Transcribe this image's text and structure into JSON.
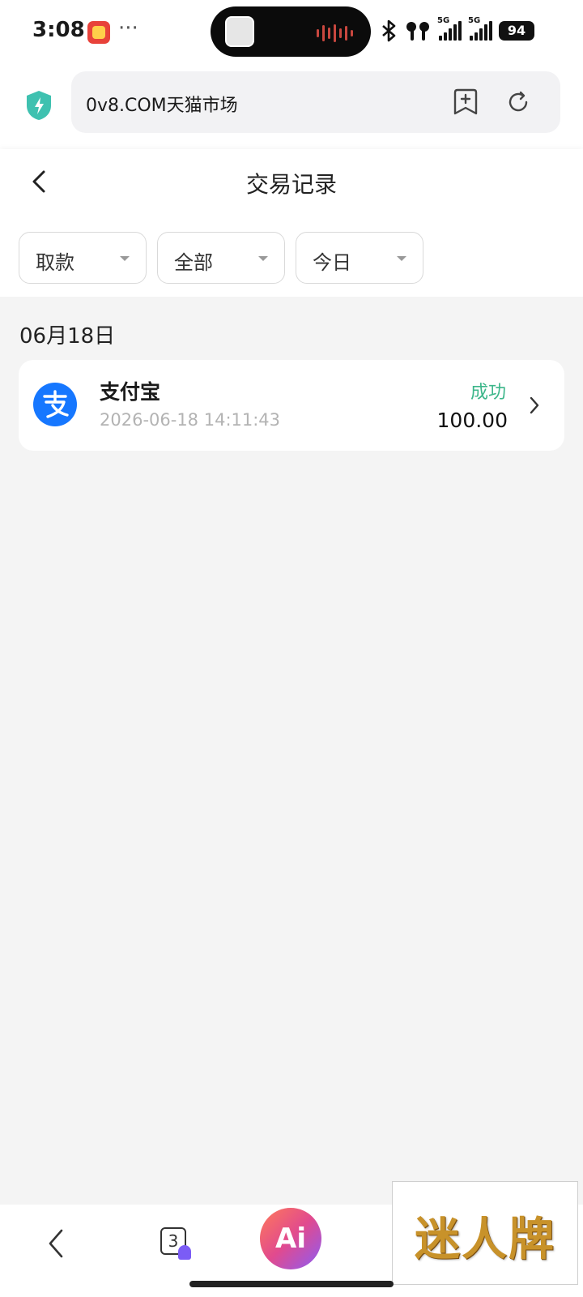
{
  "status_bar": {
    "time": "3:08",
    "more": "···",
    "network_1": "5G",
    "network_2": "5G",
    "battery": "94"
  },
  "browser": {
    "url": "0v8.COM天猫市场",
    "shield_color": "#3fc1b0"
  },
  "page": {
    "title": "交易记录"
  },
  "filters": [
    {
      "label": "取款"
    },
    {
      "label": "全部"
    },
    {
      "label": "今日"
    }
  ],
  "records_section": {
    "date": "06月18日",
    "items": [
      {
        "name": "支付宝",
        "time": "2026-06-18 14:11:43",
        "status": "成功",
        "amount": "100.00",
        "icon": "alipay-icon",
        "status_color": "#3cb68a"
      }
    ]
  },
  "bottom_nav": {
    "tabs_count": "3",
    "ai_label": "Ai"
  },
  "watermark": {
    "text": "迷人牌"
  }
}
